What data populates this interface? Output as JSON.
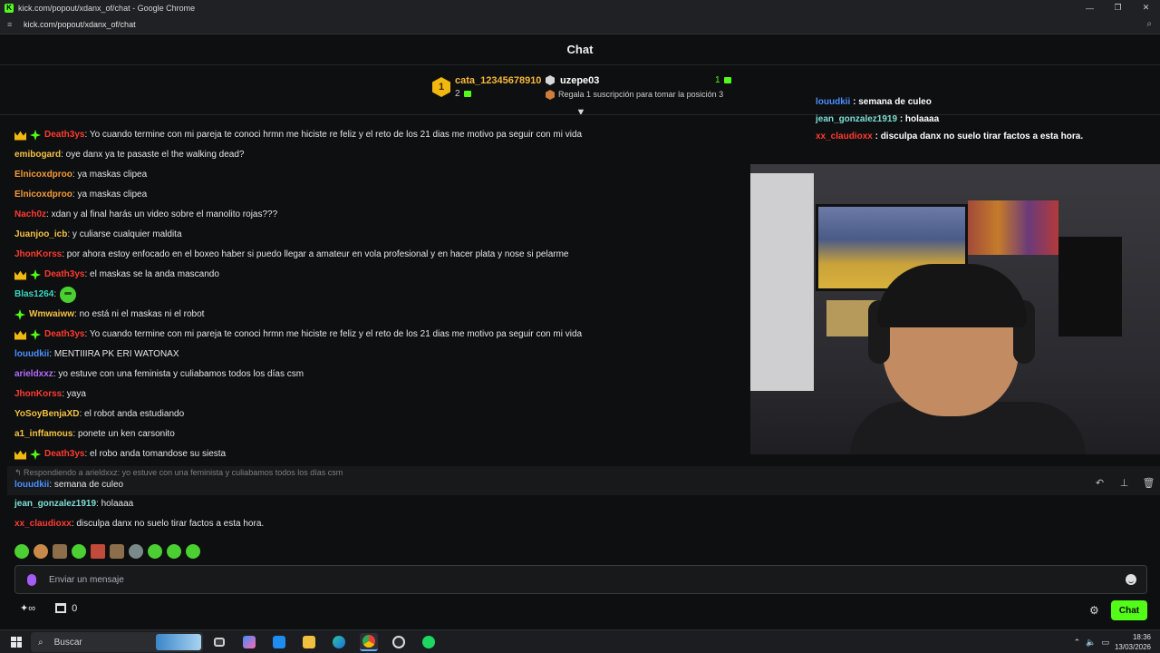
{
  "window": {
    "title": "kick.com/popout/xdanx_of/chat - Google Chrome",
    "url": "kick.com/popout/xdanx_of/chat",
    "controls": [
      "—",
      "❐",
      "✕"
    ]
  },
  "header": {
    "title": "Chat"
  },
  "leaderboard": {
    "first": {
      "rank": "1",
      "name": "cata_12345678910",
      "count": "2"
    },
    "second": {
      "name": "uzepe03",
      "count": "1"
    },
    "third": {
      "promo": "Regala 1 suscripción para tomar la posición 3"
    }
  },
  "messages": [
    {
      "badges": [
        "crown",
        "spark"
      ],
      "user": "Death3ys",
      "color": "#ff3b30",
      "text": ": Yo cuando termine con mi pareja te conoci hrmn me hiciste re feliz y el reto de los 21 dias me motivo pa seguir con mi vida"
    },
    {
      "badges": [],
      "user": "emibogard",
      "color": "#f5c242",
      "text": ": oye danx ya te pasaste el the walking dead?"
    },
    {
      "badges": [],
      "user": "Elnicoxdproo",
      "color": "#f59a36",
      "text": ": ya maskas clipea"
    },
    {
      "badges": [],
      "user": "Elnicoxdproo",
      "color": "#f59a36",
      "text": ": ya maskas clipea"
    },
    {
      "badges": [],
      "user": "Nach0z",
      "color": "#ff3b30",
      "text": ": xdan y al final harás un video sobre el manolito rojas???"
    },
    {
      "badges": [],
      "user": "Juanjoo_icb",
      "color": "#f5c242",
      "text": ": y culiarse cualquier maldita"
    },
    {
      "badges": [],
      "user": "JhonKorss",
      "color": "#ff3b30",
      "text": ": por ahora estoy enfocado en el boxeo haber si puedo llegar a amateur en vola profesional y en hacer plata y nose si pelarme"
    },
    {
      "badges": [
        "crown",
        "spark"
      ],
      "user": "Death3ys",
      "color": "#ff3b30",
      "text": ": el maskas se la anda mascando"
    },
    {
      "badges": [],
      "user": "Blas1264",
      "color": "#36d6c3",
      "text": ":",
      "emote": true
    },
    {
      "badges": [
        "spark"
      ],
      "user": "Wmwaiww",
      "color": "#f5c242",
      "text": ": no está ni el maskas ni el robot"
    },
    {
      "badges": [
        "crown",
        "spark"
      ],
      "user": "Death3ys",
      "color": "#ff3b30",
      "text": ": Yo cuando termine con mi pareja te conoci hrmn me hiciste re feliz y el reto de los 21 dias me motivo pa seguir con mi vida"
    },
    {
      "badges": [],
      "user": "louudkii",
      "color": "#4a90ff",
      "text": ": MENTIIIRA PK ERI WATONAX"
    },
    {
      "badges": [],
      "user": "arieldxxz",
      "color": "#b36bff",
      "text": ": yo estuve con una feminista y culiabamos todos los días csm"
    },
    {
      "badges": [],
      "user": "JhonKorss",
      "color": "#ff3b30",
      "text": ": yaya"
    },
    {
      "badges": [],
      "user": "YoSoyBenjaXD",
      "color": "#f5c242",
      "text": ": el robot anda estudiando"
    },
    {
      "badges": [],
      "user": "a1_inffamous",
      "color": "#f5c242",
      "text": ": ponete un ken carsonito"
    },
    {
      "badges": [
        "crown",
        "spark"
      ],
      "user": "Death3ys",
      "color": "#ff3b30",
      "text": ": el robo anda tomandose su siesta"
    }
  ],
  "reply": {
    "context": "Respondiendo a arieldxxz: yo estuve con una feminista y culiabamos todos los días csm",
    "user": "louudkii",
    "color": "#4a90ff",
    "text": ": semana de culeo"
  },
  "after_messages": [
    {
      "user": "jean_gonzalez1919",
      "color": "#7ee0d6",
      "text": ": holaaaa"
    },
    {
      "user": "xx_claudioxx",
      "color": "#ff3b30",
      "text": ": disculpa danx no suelo tirar factos a esta hora."
    }
  ],
  "overlay": [
    {
      "user": "louudkii",
      "color": "#4a90ff",
      "text": " : semana de culeo"
    },
    {
      "user": "jean_gonzalez1919",
      "color": "#7ee0d6",
      "text": " : holaaaa"
    },
    {
      "user": "xx_claudioxx",
      "color": "#ff3b30",
      "text": " : disculpa danx no suelo tirar factos a esta hora."
    }
  ],
  "input": {
    "placeholder": "Enviar un mensaje"
  },
  "bottom": {
    "points": "0",
    "chat_button": "Chat"
  },
  "taskbar": {
    "search": "Buscar",
    "time": "18:36",
    "date": "13/03/2026"
  },
  "colors": {
    "accent": "#53fc18",
    "background": "#0e0f10"
  }
}
